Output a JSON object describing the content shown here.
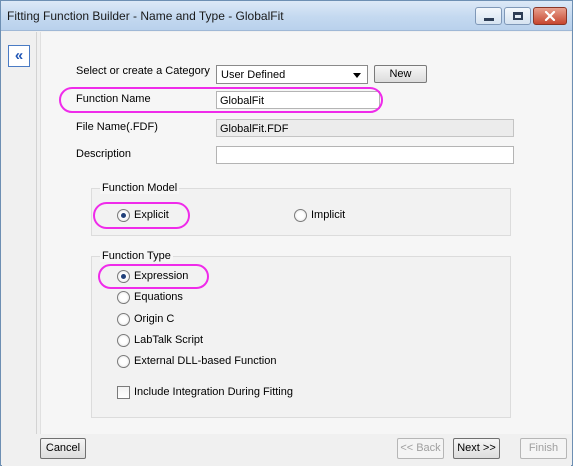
{
  "window": {
    "title": "Fitting Function Builder - Name and Type - GlobalFit",
    "collapse_glyph": "«"
  },
  "form": {
    "category_label": "Select or create a Category",
    "category_value": "User Defined",
    "new_button": "New",
    "function_name_label": "Function Name",
    "function_name_value": "GlobalFit",
    "file_name_label": "File Name(.FDF)",
    "file_name_value": "GlobalFit.FDF",
    "description_label": "Description",
    "description_value": ""
  },
  "function_model": {
    "title": "Function Model",
    "explicit": "Explicit",
    "implicit": "Implicit",
    "selected": "explicit"
  },
  "function_type": {
    "title": "Function Type",
    "options": [
      "Expression",
      "Equations",
      "Origin C",
      "LabTalk Script",
      "External DLL-based Function"
    ],
    "selected_index": 0,
    "include_integration": "Include Integration During Fitting",
    "include_integration_checked": false
  },
  "footer": {
    "cancel": "Cancel",
    "back": "<< Back",
    "next": "Next >>",
    "finish": "Finish"
  },
  "colors": {
    "highlight": "#ef2bea",
    "title_bar": "#c4d9f0",
    "radio_dot": "#21407a"
  },
  "icons": {
    "collapse": "double-chevron-left-icon",
    "minimize": "minimize-icon",
    "maximize": "maximize-icon",
    "close": "close-icon"
  }
}
